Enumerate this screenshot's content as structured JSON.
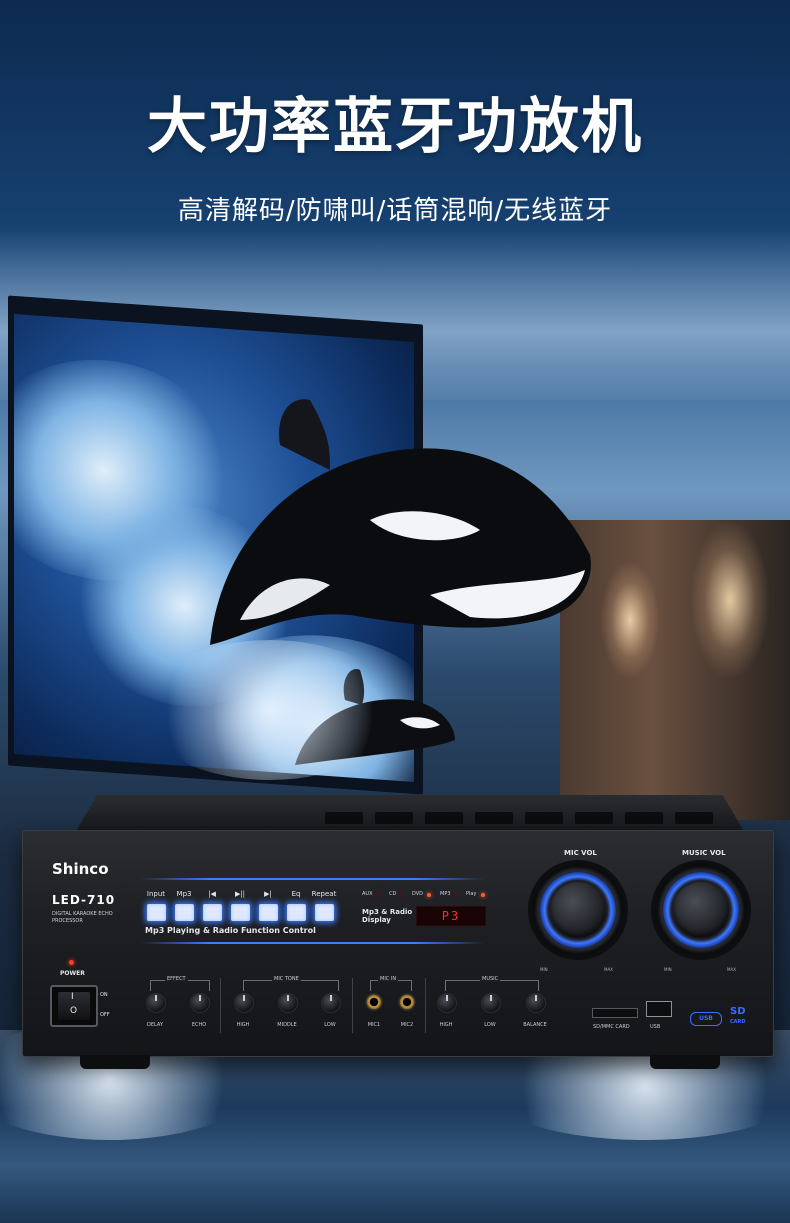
{
  "headline": "大功率蓝牙功放机",
  "subheadline": "高清解码/防啸叫/话筒混响/无线蓝牙",
  "amplifier": {
    "brand": "Shinco",
    "model": "LED-710",
    "model_desc": "DIGITAL KARAOKE ECHO PROCESSOR",
    "panel": {
      "buttons": [
        "Input",
        "Mp3",
        "|◀",
        "▶||",
        "▶|",
        "Eq",
        "Repeat"
      ],
      "caption": "Mp3 Playing & Radio Function Control",
      "sources": [
        "AUX",
        "CD",
        "DVD",
        "MP3",
        "Play"
      ],
      "display_caption": "Mp3 & Radio Display",
      "display_value": "P3"
    },
    "knobs": {
      "mic_vol": "MIC VOL",
      "music_vol": "MUSIC VOL",
      "min": "MIN",
      "max": "MAX"
    },
    "power": {
      "label": "POWER",
      "on": "ON",
      "off": "OFF",
      "mark_on": "I",
      "mark_off": "O"
    },
    "groups": {
      "effect": {
        "title": "EFFECT",
        "labels": [
          "DELAY",
          "ECHO"
        ]
      },
      "mic_tone": {
        "title": "MIC TONE",
        "labels": [
          "HIGH",
          "MIDDLE",
          "LOW"
        ]
      },
      "mic_in": {
        "title": "MIC IN",
        "labels": [
          "MIC1",
          "MIC2"
        ]
      },
      "music": {
        "title": "MUSIC",
        "labels": [
          "HIGH",
          "LOW",
          "BALANCE"
        ]
      }
    },
    "ports": {
      "sd_mmc": "SD/MMC CARD",
      "usb": "USB",
      "usb_logo": "USB",
      "sd_logo": "SD",
      "sd_logo_sub": "CARD"
    }
  }
}
